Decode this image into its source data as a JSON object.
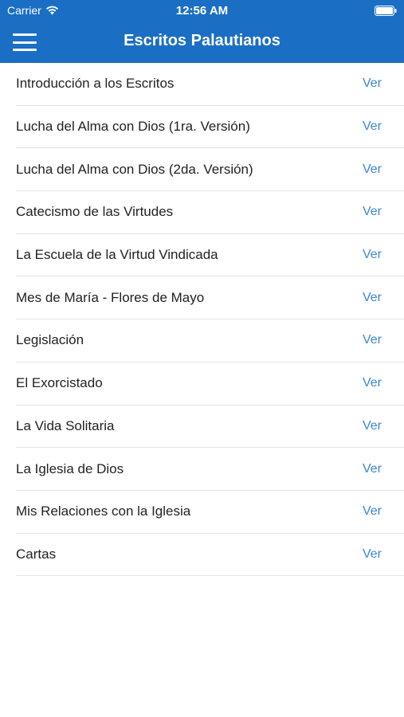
{
  "status_bar": {
    "carrier": "Carrier",
    "time": "12:56 AM",
    "wifi_icon": "wifi-icon",
    "battery_icon": "battery-icon"
  },
  "nav": {
    "title": "Escritos Palautianos",
    "menu_icon": "hamburger-menu-icon",
    "background_color": "#1a6fc4"
  },
  "link_color": "#3b86d6",
  "items": [
    {
      "label": "Introducción a los Escritos",
      "action": "Ver"
    },
    {
      "label": "Lucha del Alma con Dios (1ra. Versión)",
      "action": "Ver"
    },
    {
      "label": "Lucha del Alma con Dios (2da. Versión)",
      "action": "Ver"
    },
    {
      "label": "Catecismo de las Virtudes",
      "action": "Ver"
    },
    {
      "label": "La Escuela de la Virtud Vindicada",
      "action": "Ver"
    },
    {
      "label": "Mes de María - Flores de Mayo",
      "action": "Ver"
    },
    {
      "label": "Legislación",
      "action": "Ver"
    },
    {
      "label": "El Exorcistado",
      "action": "Ver"
    },
    {
      "label": "La Vida Solitaria",
      "action": "Ver"
    },
    {
      "label": "La Iglesia de Dios",
      "action": "Ver"
    },
    {
      "label": "Mis Relaciones con la Iglesia",
      "action": "Ver"
    },
    {
      "label": "Cartas",
      "action": "Ver"
    }
  ]
}
